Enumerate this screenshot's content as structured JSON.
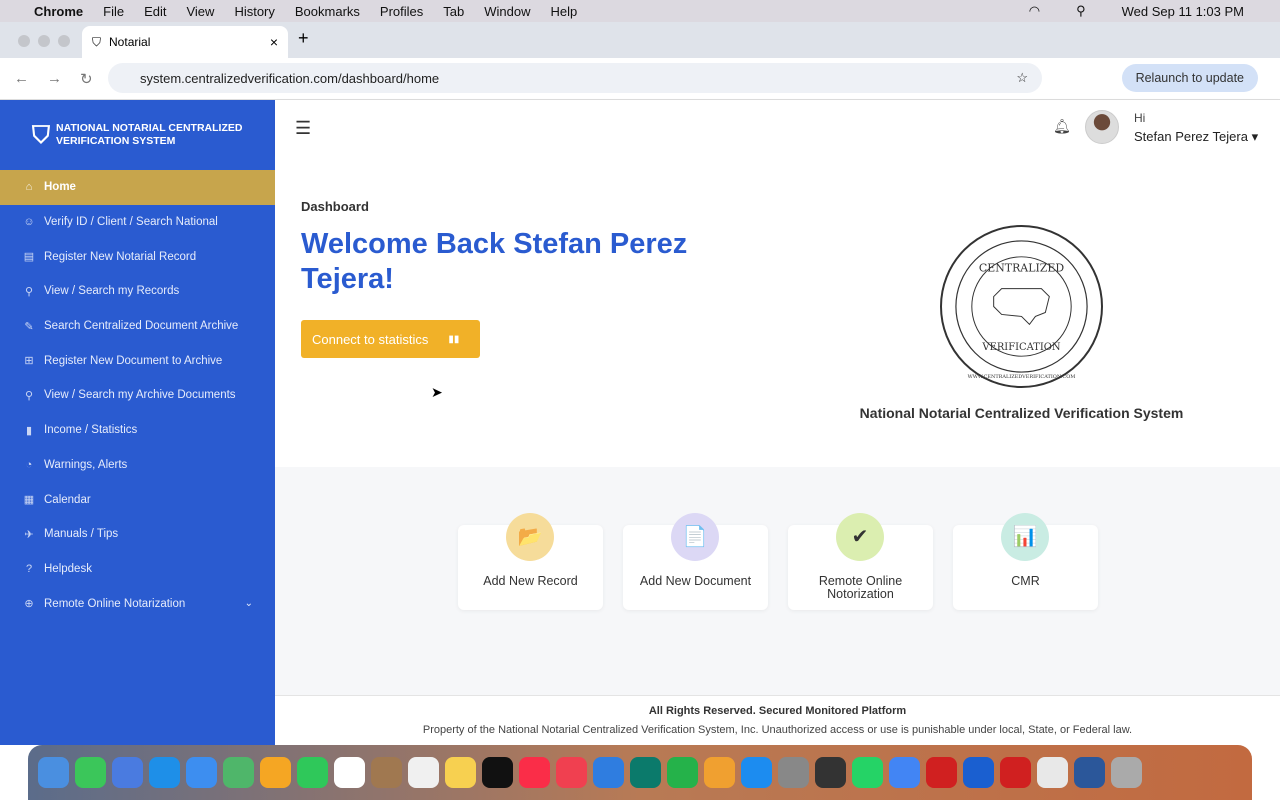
{
  "menubar": {
    "app": "Chrome",
    "items": [
      "File",
      "Edit",
      "View",
      "History",
      "Bookmarks",
      "Profiles",
      "Tab",
      "Window",
      "Help"
    ],
    "clock": "Wed Sep 11  1:03 PM"
  },
  "browser": {
    "tab_title": "Notarial",
    "url": "system.centralizedverification.com/dashboard/home",
    "relaunch": "Relaunch to update"
  },
  "sidebar": {
    "brand_line1": "NATIONAL NOTARIAL CENTRALIZED",
    "brand_line2": "VERIFICATION SYSTEM",
    "items": [
      {
        "label": "Home",
        "icon": "⌂"
      },
      {
        "label": "Verify ID / Client / Search National",
        "icon": "☺"
      },
      {
        "label": "Register New Notarial Record",
        "icon": "▤"
      },
      {
        "label": "View / Search my Records",
        "icon": "⚲"
      },
      {
        "label": "Search Centralized Document Archive",
        "icon": "✎"
      },
      {
        "label": "Register New Document to Archive",
        "icon": "⊞"
      },
      {
        "label": "View / Search my Archive Documents",
        "icon": "⚲"
      },
      {
        "label": "Income / Statistics",
        "icon": "▮"
      },
      {
        "label": "Warnings, Alerts",
        "icon": "◔"
      },
      {
        "label": "Calendar",
        "icon": "▦"
      },
      {
        "label": "Manuals / Tips",
        "icon": "✈"
      },
      {
        "label": "Helpdesk",
        "icon": "?"
      },
      {
        "label": "Remote Online Notarization",
        "icon": "⊕"
      }
    ]
  },
  "header": {
    "greeting": "Hi",
    "user": "Stefan Perez Tejera"
  },
  "main": {
    "breadcrumb": "Dashboard",
    "welcome": "Welcome Back Stefan Perez Tejera!",
    "cta": "Connect to statistics",
    "seal_top": "CENTRALIZED",
    "seal_bottom": "VERIFICATION",
    "seal_url": "WWW.CENTRALIZEDVERIFICATION.COM",
    "system_name": "National Notarial Centralized Verification System",
    "cards": [
      {
        "label": "Add New Record",
        "icon": "📂",
        "color": "#f6dc9a"
      },
      {
        "label": "Add New Document",
        "icon": "📄",
        "color": "#dcd8f5"
      },
      {
        "label": "Remote Online Notorization",
        "icon": "✔",
        "color": "#dbeeb0"
      },
      {
        "label": "CMR",
        "icon": "📊",
        "color": "#c9ece3"
      }
    ]
  },
  "footer": {
    "title": "All Rights Reserved. Secured Monitored Platform",
    "text": "Property of the National Notarial Centralized Verification System, Inc. Unauthorized access or use is punishable under local, State, or Federal law."
  },
  "dock": {
    "colors": [
      "#4a8fe0",
      "#3bc65a",
      "#4a7be0",
      "#1e8fe8",
      "#3d8ef0",
      "#4fb66a",
      "#f5a623",
      "#2fc85a",
      "#ffffff",
      "#a07850",
      "#f0f0f0",
      "#f7d050",
      "#111111",
      "#fa2d48",
      "#f04050",
      "#2f7de0",
      "#0b7a6b",
      "#25b24a",
      "#f0a030",
      "#1c8cf0",
      "#888888",
      "#333333",
      "#25d366",
      "#4285f4",
      "#d02020",
      "#1a5fd0",
      "#d02020",
      "#e8e8e8",
      "#2b579a",
      "#aaaaaa"
    ]
  }
}
